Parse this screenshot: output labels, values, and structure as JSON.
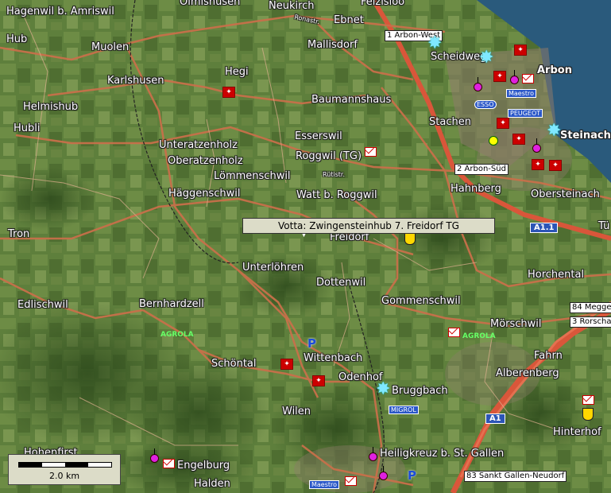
{
  "map": {
    "tooltip": "Votta: Zwingensteinhub 7. Freidorf TG",
    "scale_label": "2.0 km",
    "colors": {
      "terrain": "#5d7c3a",
      "road": "#c8704a",
      "motorway": "#d9563a",
      "lake": "#2a5a7c",
      "poi": "#e020e0"
    },
    "places": [
      {
        "name": "Hagenwil b. Amriswil"
      },
      {
        "name": "Olmishusen"
      },
      {
        "name": "Neukirch"
      },
      {
        "name": "Ebnet"
      },
      {
        "name": "Felzisloo"
      },
      {
        "name": "Hub"
      },
      {
        "name": "Muolen"
      },
      {
        "name": "Mallisdorf"
      },
      {
        "name": "Scheidweg"
      },
      {
        "name": "Arbon"
      },
      {
        "name": "Karlshusen"
      },
      {
        "name": "Hegi"
      },
      {
        "name": "Helmishub"
      },
      {
        "name": "Baumannshaus"
      },
      {
        "name": "Stachen"
      },
      {
        "name": "Hubli"
      },
      {
        "name": "Esserswil"
      },
      {
        "name": "Steinach"
      },
      {
        "name": "Unteratzenholz"
      },
      {
        "name": "Oberatzenholz"
      },
      {
        "name": "Roggwil (TG)"
      },
      {
        "name": "Lömmenschwil"
      },
      {
        "name": "Häggenschwil"
      },
      {
        "name": "Watt b. Roggwil"
      },
      {
        "name": "Hahnberg"
      },
      {
        "name": "Obersteinach"
      },
      {
        "name": "Tron"
      },
      {
        "name": "Freidorf"
      },
      {
        "name": "Tü"
      },
      {
        "name": "Unterlöhren"
      },
      {
        "name": "Dottenwil"
      },
      {
        "name": "Horchental"
      },
      {
        "name": "Edlischwil"
      },
      {
        "name": "Bernhardzell"
      },
      {
        "name": "Gommenschwil"
      },
      {
        "name": "Mörschwil"
      },
      {
        "name": "Wittenbach"
      },
      {
        "name": "Schöntal"
      },
      {
        "name": "Fahrn"
      },
      {
        "name": "Odenhof"
      },
      {
        "name": "Alberenberg"
      },
      {
        "name": "Bruggbach"
      },
      {
        "name": "Wilen"
      },
      {
        "name": "Hinterhof"
      },
      {
        "name": "Hohenfirst"
      },
      {
        "name": "Heiligkreuz b. St. Gallen"
      },
      {
        "name": "Engelburg"
      },
      {
        "name": "Halden"
      }
    ],
    "exits": [
      {
        "label": "1 Arbon-West"
      },
      {
        "label": "2 Arbon-Süd"
      },
      {
        "label": "84 Meggen"
      },
      {
        "label": "3 Rorscha"
      },
      {
        "label": "83 Sankt Gallen-Neudorf"
      }
    ],
    "motorway_labels": [
      {
        "label": "A1.1"
      },
      {
        "label": "A1"
      }
    ],
    "brands": [
      {
        "label": "Maestro"
      },
      {
        "label": "PEUGEOT"
      },
      {
        "label": "ESSO"
      },
      {
        "label": "MIGROL"
      },
      {
        "label": "Maestro"
      }
    ],
    "fuel_labels": [
      {
        "label": "AGROLA"
      },
      {
        "label": "AGROLA"
      }
    ],
    "road_labels": [
      {
        "label": "Rütistr."
      },
      {
        "label": "Ronastr."
      }
    ]
  }
}
